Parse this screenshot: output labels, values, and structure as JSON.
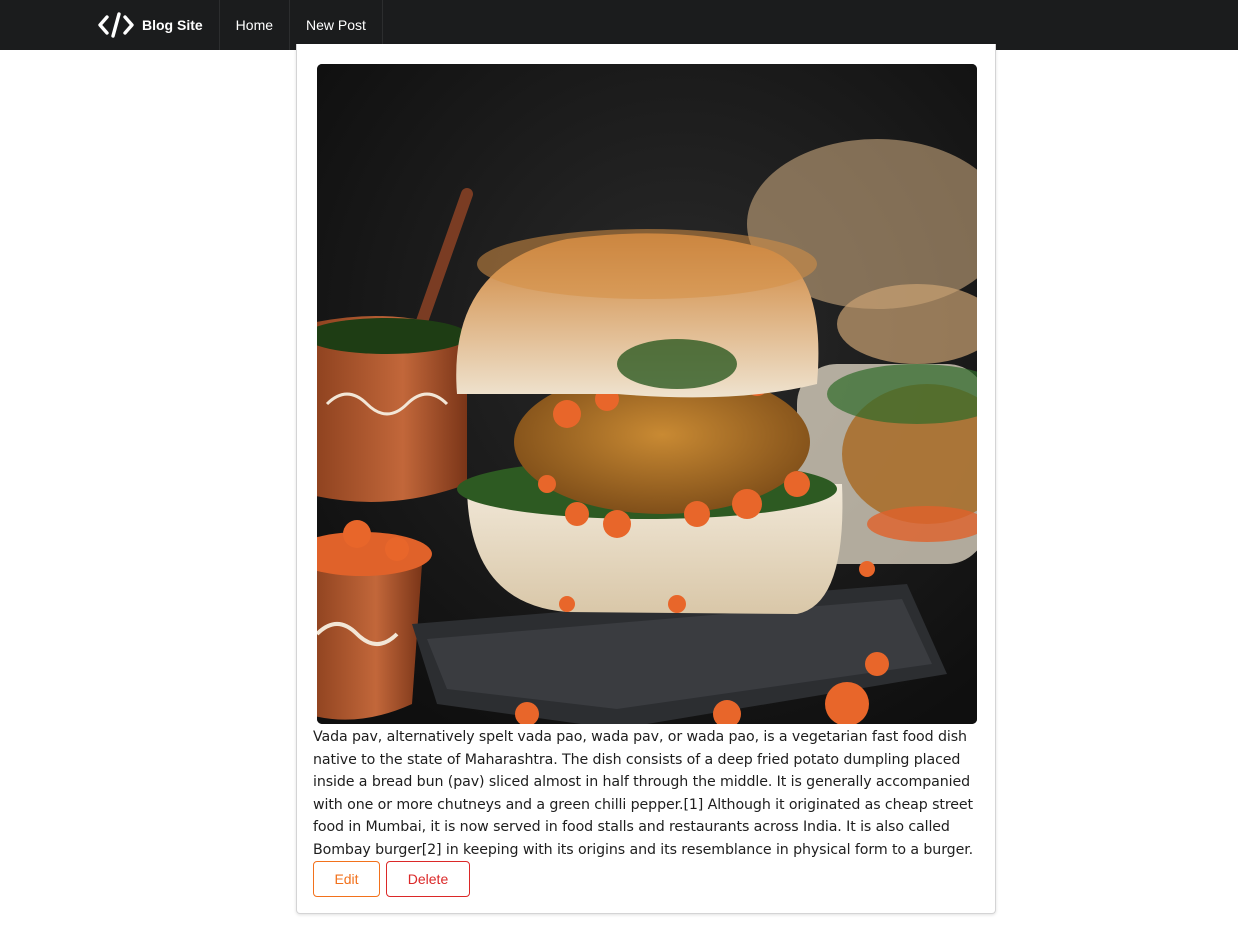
{
  "nav": {
    "brand": "Blog Site",
    "home": "Home",
    "new_post": "New Post"
  },
  "post": {
    "body": "Vada pav, alternatively spelt vada pao, wada pav, or wada pao, is a vegetarian fast food dish native to the state of Maharashtra. The dish consists of a deep fried potato dumpling placed inside a bread bun (pav) sliced almost in half through the middle. It is generally accompanied with one or more chutneys and a green chilli pepper.[1] Although it originated as cheap street food in Mumbai, it is now served in food stalls and restaurants across India. It is also called Bombay burger[2] in keeping with its origins and its resemblance in physical form to a burger.[3]",
    "edit_label": "Edit",
    "delete_label": "Delete"
  },
  "colors": {
    "navbar": "#1b1c1d",
    "edit": "#f2711c",
    "delete": "#db2828"
  },
  "icons": {
    "brand": "code-icon"
  }
}
